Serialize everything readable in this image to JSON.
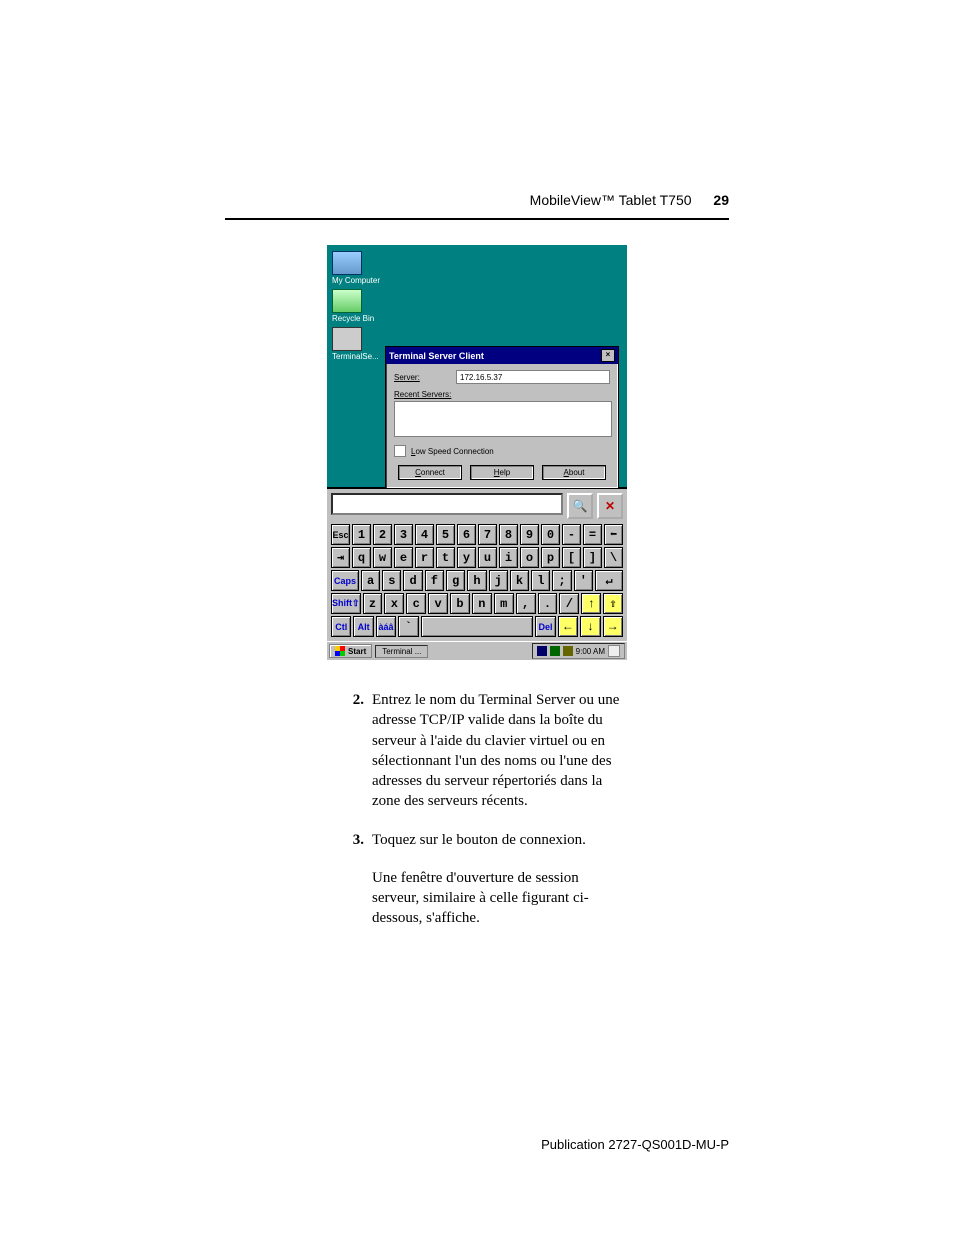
{
  "header": {
    "title": "MobileView™ Tablet T750",
    "page_number": "29"
  },
  "desktop_icons": {
    "my_computer": "My Computer",
    "recycle_bin": "Recycle Bin",
    "terminal": "TerminalSe..."
  },
  "dialog": {
    "title": "Terminal Server Client",
    "server_label_pre": "S",
    "server_label_post": "erver:",
    "server_value": "172.16.5.37",
    "recent_label_pre": "R",
    "recent_label_post": "ecent Servers:",
    "low_speed_pre": "L",
    "low_speed_post": "ow Speed Connection",
    "connect_pre": "C",
    "connect_post": "onnect",
    "help_pre": "H",
    "help_post": "elp",
    "about_pre": "A",
    "about_post": "bout",
    "close": "×"
  },
  "osk": {
    "magnify": "🔍",
    "close": "✕"
  },
  "keyboard": {
    "r1": [
      "Esc",
      "1",
      "2",
      "3",
      "4",
      "5",
      "6",
      "7",
      "8",
      "9",
      "0",
      "-",
      "=",
      "⬅"
    ],
    "r2": [
      "⇥",
      "q",
      "w",
      "e",
      "r",
      "t",
      "y",
      "u",
      "i",
      "o",
      "p",
      "[",
      "]",
      "\\"
    ],
    "r3": [
      "Caps",
      "a",
      "s",
      "d",
      "f",
      "g",
      "h",
      "j",
      "k",
      "l",
      ";",
      "'",
      "↵"
    ],
    "r4": [
      "Shift⇧",
      "z",
      "x",
      "c",
      "v",
      "b",
      "n",
      "m",
      ",",
      ".",
      "/",
      "↑",
      "⇧"
    ],
    "r5": [
      "Ctl",
      "Alt",
      "àáâ",
      "`",
      " ",
      "Del",
      "←",
      "↓",
      "→"
    ]
  },
  "taskbar": {
    "start": "Start",
    "task1": "Terminal ...",
    "clock": "9:00 AM"
  },
  "body": {
    "step2_num": "2.",
    "step2_text": "Entrez le nom du Terminal Server ou une adresse TCP/IP valide dans la boîte du serveur à l'aide du clavier virtuel ou en sélectionnant l'un des noms ou l'une des adresses du serveur répertoriés dans la zone des serveurs récents.",
    "step3_num": "3.",
    "step3_text": "Toquez sur le bouton de connexion.",
    "followup": "Une fenêtre d'ouverture de session serveur, similaire à celle figurant ci-dessous, s'affiche."
  },
  "footer": {
    "publication": "Publication 2727-QS001D-MU-P"
  }
}
